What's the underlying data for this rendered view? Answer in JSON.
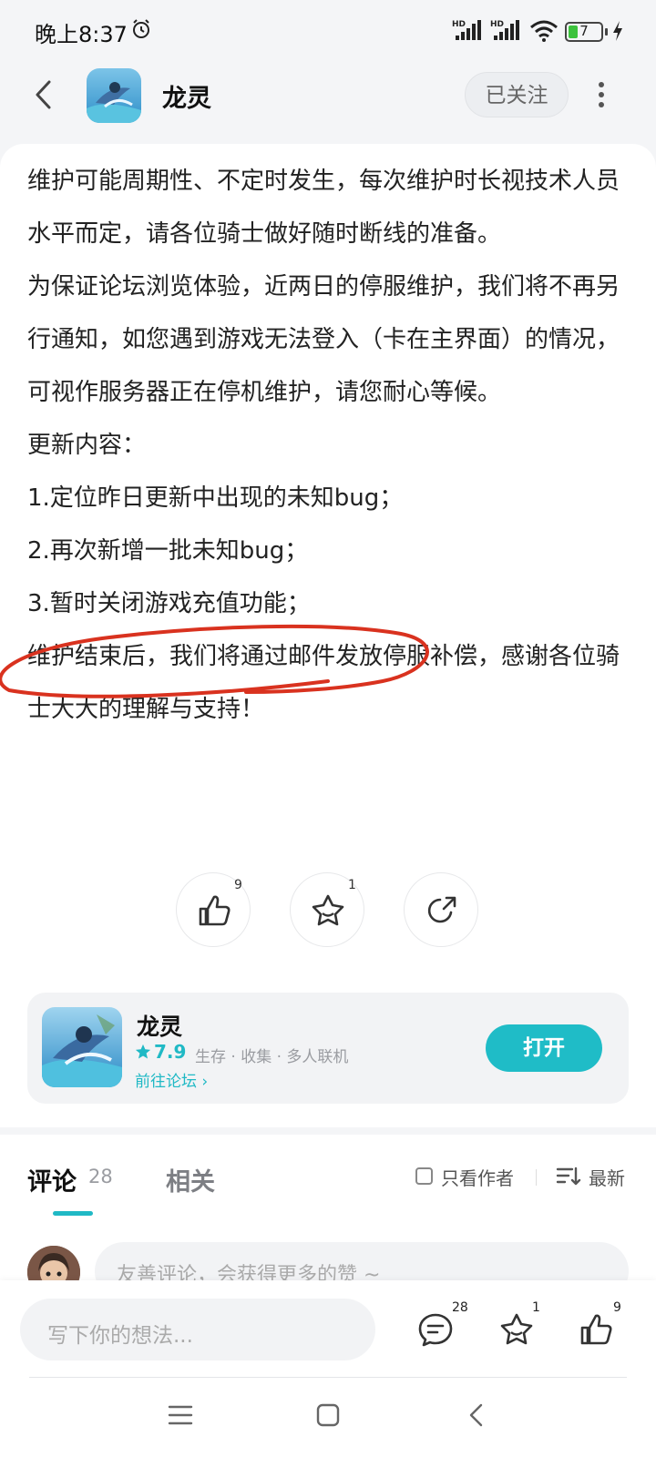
{
  "status_bar": {
    "time": "晚上8:37",
    "signal1_label": "HD",
    "signal2_label": "HD",
    "battery": "7"
  },
  "header": {
    "app_name": "龙灵",
    "follow_label": "已关注"
  },
  "article": {
    "paragraphs": [
      "维护可能周期性、不定时发生，每次维护时长视技术人员水平而定，请各位骑士做好随时断线的准备。",
      "为保证论坛浏览体验，近两日的停服维护，我们将不再另行通知，如您遇到游戏无法登入（卡在主界面）的情况，可视作服务器正在停机维护，请您耐心等候。",
      "更新内容：",
      "1.定位昨日更新中出现的未知bug；",
      "2.再次新增一批未知bug；",
      "3.暂时关闭游戏充值功能；",
      "维护结束后，我们将通过邮件发放停服补偿，感谢各位骑士大大的理解与支持！"
    ]
  },
  "reactions": {
    "like_count": "9",
    "favorite_count": "1"
  },
  "game_card": {
    "name": "龙灵",
    "rating": "7.9",
    "tags": "生存 · 收集 · 多人联机",
    "forum_link": "前往论坛 ",
    "open_label": "打开"
  },
  "comments": {
    "tab_comments": "评论",
    "comment_count": "28",
    "tab_related": "相关",
    "only_author": "只看作者",
    "sort_label": "最新",
    "friendly_placeholder": "友善评论，会获得更多的赞 ~"
  },
  "bottom_bar": {
    "input_placeholder": "写下你的想法...",
    "comment_count": "28",
    "favorite_count": "1",
    "like_count": "9"
  },
  "colors": {
    "accent": "#1fbcc7",
    "annotation": "#d9321f"
  }
}
